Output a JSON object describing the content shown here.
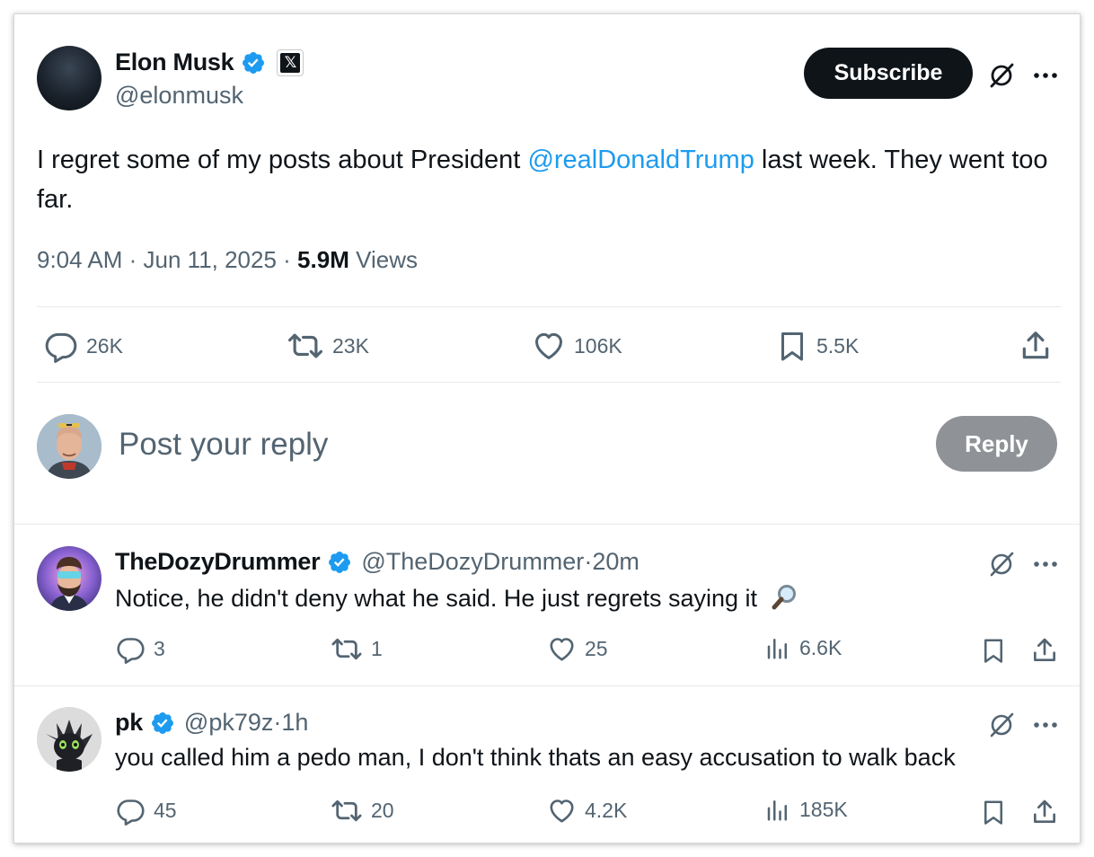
{
  "main_post": {
    "author": {
      "name": "Elon Musk",
      "handle": "@elonmusk"
    },
    "subscribe_label": "Subscribe",
    "text_before": "I regret some of my posts about President ",
    "mention": "@realDonaldTrump",
    "text_after": " last week. They went too far.",
    "time": "9:04 AM",
    "date": "Jun 11, 2025",
    "views_count": "5.9M",
    "views_label": "Views",
    "separator": " · ",
    "actions": {
      "replies": "26K",
      "reposts": "23K",
      "likes": "106K",
      "bookmarks": "5.5K"
    }
  },
  "composer": {
    "placeholder": "Post your reply",
    "reply_button": "Reply"
  },
  "replies": [
    {
      "name": "TheDozyDrummer",
      "handle": "@TheDozyDrummer",
      "time": "20m",
      "text": "Notice, he didn't deny what he said. He just regrets saying it",
      "emoji": "🔎",
      "actions": {
        "replies": "3",
        "reposts": "1",
        "likes": "25",
        "views": "6.6K"
      }
    },
    {
      "name": "pk",
      "handle": "@pk79z",
      "time": "1h",
      "text": "you called him a pedo man, I don't think thats an easy accusation to walk back",
      "actions": {
        "replies": "45",
        "reposts": "20",
        "likes": "4.2K",
        "views": "185K"
      }
    }
  ],
  "icons": {
    "verified": "verified-badge-icon",
    "x_logo": "x-logo-icon",
    "grok": "grok-icon",
    "more": "more-icon",
    "reply": "reply-icon",
    "repost": "repost-icon",
    "like": "like-icon",
    "bookmark": "bookmark-icon",
    "views": "views-icon",
    "share": "share-icon"
  },
  "colors": {
    "accent": "#1d9bf0",
    "text_primary": "#0f1419",
    "text_secondary": "#536471",
    "reply_button_disabled": "#8f9397"
  }
}
